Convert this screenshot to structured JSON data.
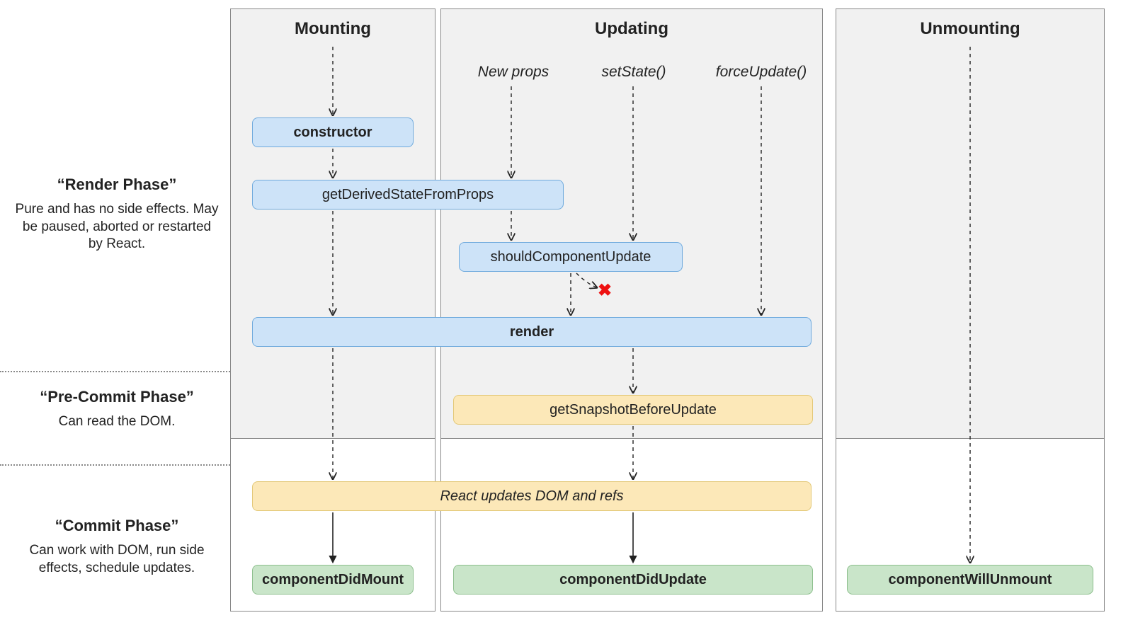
{
  "columns": {
    "mounting": "Mounting",
    "updating": "Updating",
    "unmounting": "Unmounting"
  },
  "phases": {
    "render": {
      "title": "“Render Phase”",
      "desc": "Pure and has no side effects. May be paused, aborted or restarted by React."
    },
    "precommit": {
      "title": "“Pre-Commit Phase”",
      "desc": "Can read the DOM."
    },
    "commit": {
      "title": "“Commit Phase”",
      "desc": "Can work with DOM, run side effects, schedule updates."
    }
  },
  "triggers": {
    "newProps": "New props",
    "setState": "setState()",
    "forceUpdate": "forceUpdate()"
  },
  "boxes": {
    "constructor": "constructor",
    "gdsfp": "getDerivedStateFromProps",
    "scu": "shouldComponentUpdate",
    "render": "render",
    "gsbu": "getSnapshotBeforeUpdate",
    "reactUpdates": "React updates DOM and refs",
    "cdm": "componentDidMount",
    "cdu": "componentDidUpdate",
    "cwu": "componentWillUnmount"
  },
  "xmark": "✖"
}
